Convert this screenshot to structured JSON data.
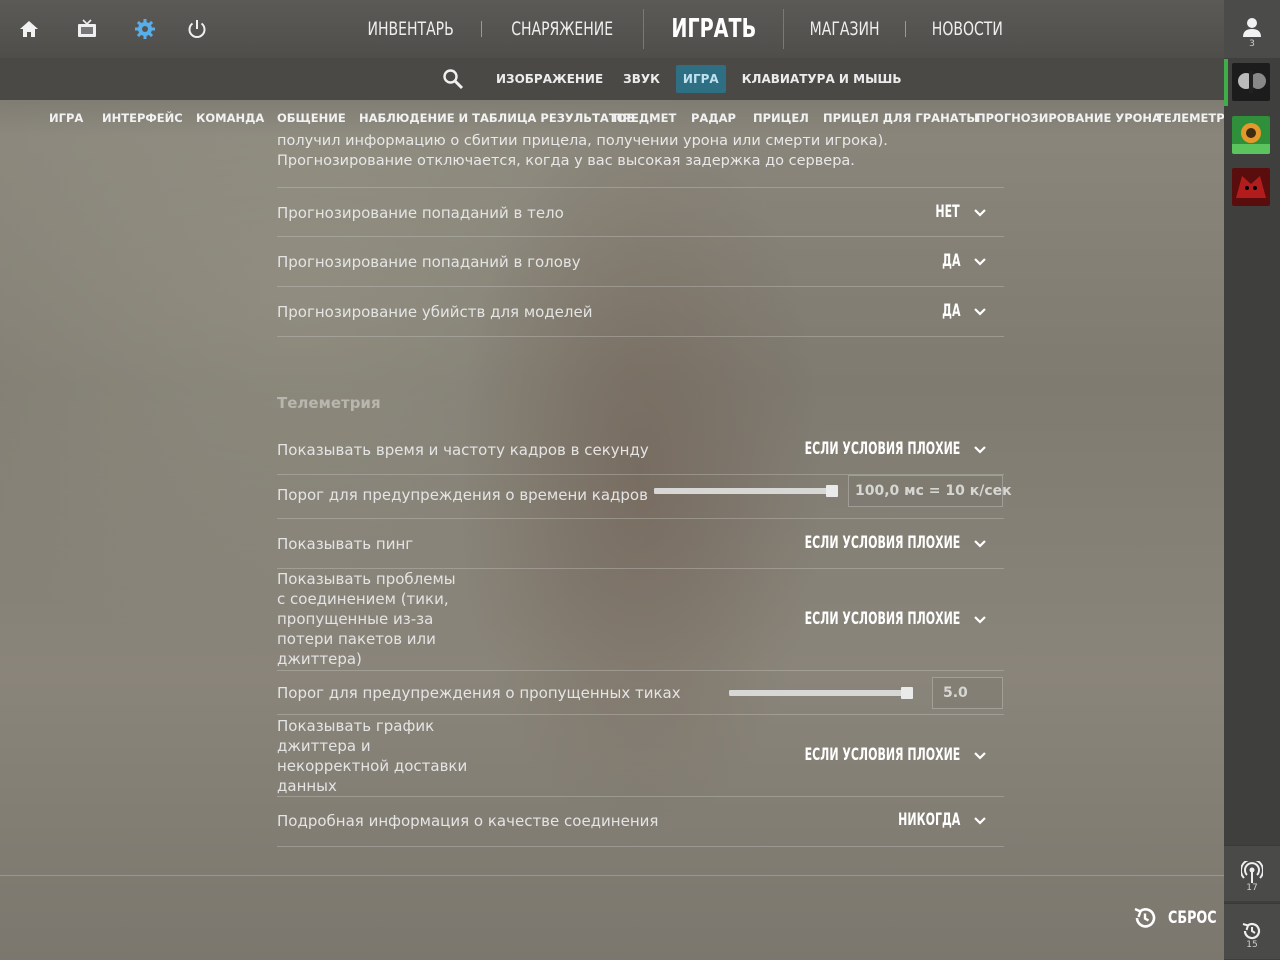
{
  "topnav": {
    "icons": [
      "home-icon",
      "tv-icon",
      "gear-icon",
      "power-icon"
    ],
    "items": [
      "ИНВЕНТАРЬ",
      "СНАРЯЖЕНИЕ",
      "ИГРАТЬ",
      "МАГАЗИН",
      "НОВОСТИ"
    ]
  },
  "subnav": {
    "search_icon": "search-icon",
    "items": [
      "ИЗОБРАЖЕНИЕ",
      "ЗВУК",
      "ИГРА",
      "КЛАВИАТУРА И МЫШЬ"
    ],
    "active": "ИГРА"
  },
  "categories": [
    "ИГРА",
    "ИНТЕРФЕЙС",
    "КОМАНДА",
    "ОБЩЕНИЕ",
    "НАБЛЮДЕНИЕ И ТАБЛИЦА РЕЗУЛЬТАТОВ",
    "ПРЕДМЕТ",
    "РАДАР",
    "ПРИЦЕЛ",
    "ПРИЦЕЛ ДЛЯ ГРАНАТЫ",
    "ПРОГНОЗИРОВАНИЕ УРОНА",
    "ТЕЛЕМЕТРИ"
  ],
  "intro_text": [
    "получил информацию о сбитии прицела, получении урона или смерти игрока).",
    "Прогнозирование отключается, когда у вас высокая задержка до сервера."
  ],
  "prediction_settings": [
    {
      "label": "Прогнозирование попаданий в тело",
      "value": "НЕТ"
    },
    {
      "label": "Прогнозирование попаданий в голову",
      "value": "ДА"
    },
    {
      "label": "Прогнозирование убийств для моделей",
      "value": "ДА"
    }
  ],
  "telemetry": {
    "title": "Телеметрия",
    "fps_label": "Показывать время и частоту кадров в секунду",
    "fps_value": "ЕСЛИ УСЛОВИЯ ПЛОХИЕ",
    "frametime_label": "Порог для предупреждения о времени кадров",
    "frametime_value": "100,0 мс = 10 к/сек",
    "frametime_fraction": 1.0,
    "ping_label": "Показывать пинг",
    "ping_value": "ЕСЛИ УСЛОВИЯ ПЛОХИЕ",
    "conn_label_lines": [
      "Показывать проблемы",
      "с соединением (тики,",
      "пропущенные из-за",
      "потери пакетов или",
      "джиттера)"
    ],
    "conn_value": "ЕСЛИ УСЛОВИЯ ПЛОХИЕ",
    "ticks_label": "Порог для предупреждения о пропущенных тиках",
    "ticks_value": "5.0",
    "ticks_fraction": 1.0,
    "jitter_label_lines": [
      "Показывать график",
      "джиттера и",
      "некорректной доставки",
      "данных"
    ],
    "jitter_value": "ЕСЛИ УСЛОВИЯ ПЛОХИЕ",
    "detail_label": "Подробная информация о качестве соединения",
    "detail_value": "НИКОГДА"
  },
  "rail": {
    "friends_count": "3",
    "bottom1_count": "17",
    "bottom2_count": "15"
  },
  "reset_label": "СБРОС"
}
